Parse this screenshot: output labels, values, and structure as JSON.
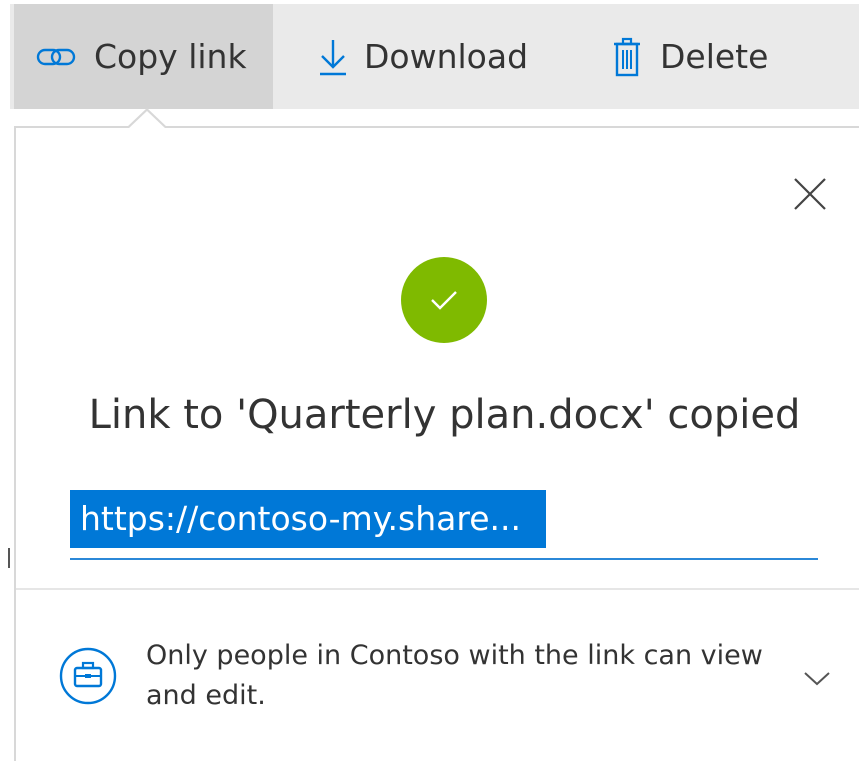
{
  "toolbar": {
    "copy_link_label": "Copy link",
    "download_label": "Download",
    "delete_label": "Delete"
  },
  "dialog": {
    "copied_message": "Link to 'Quarterly plan.docx' copied",
    "link_value": "https://contoso-my.share...",
    "permission_text": "Only people in Contoso with the link can view and edit."
  },
  "icons": {
    "copy_link": "link-icon",
    "download": "download-icon",
    "delete": "trash-icon",
    "close": "close-icon",
    "success": "checkmark-icon",
    "permission": "briefcase-icon",
    "expand": "chevron-down-icon"
  },
  "colors": {
    "accent": "#0078d7",
    "success": "#7fba00",
    "toolbar_bg": "#eaeaea",
    "toolbar_selected_bg": "#d4d4d4"
  }
}
